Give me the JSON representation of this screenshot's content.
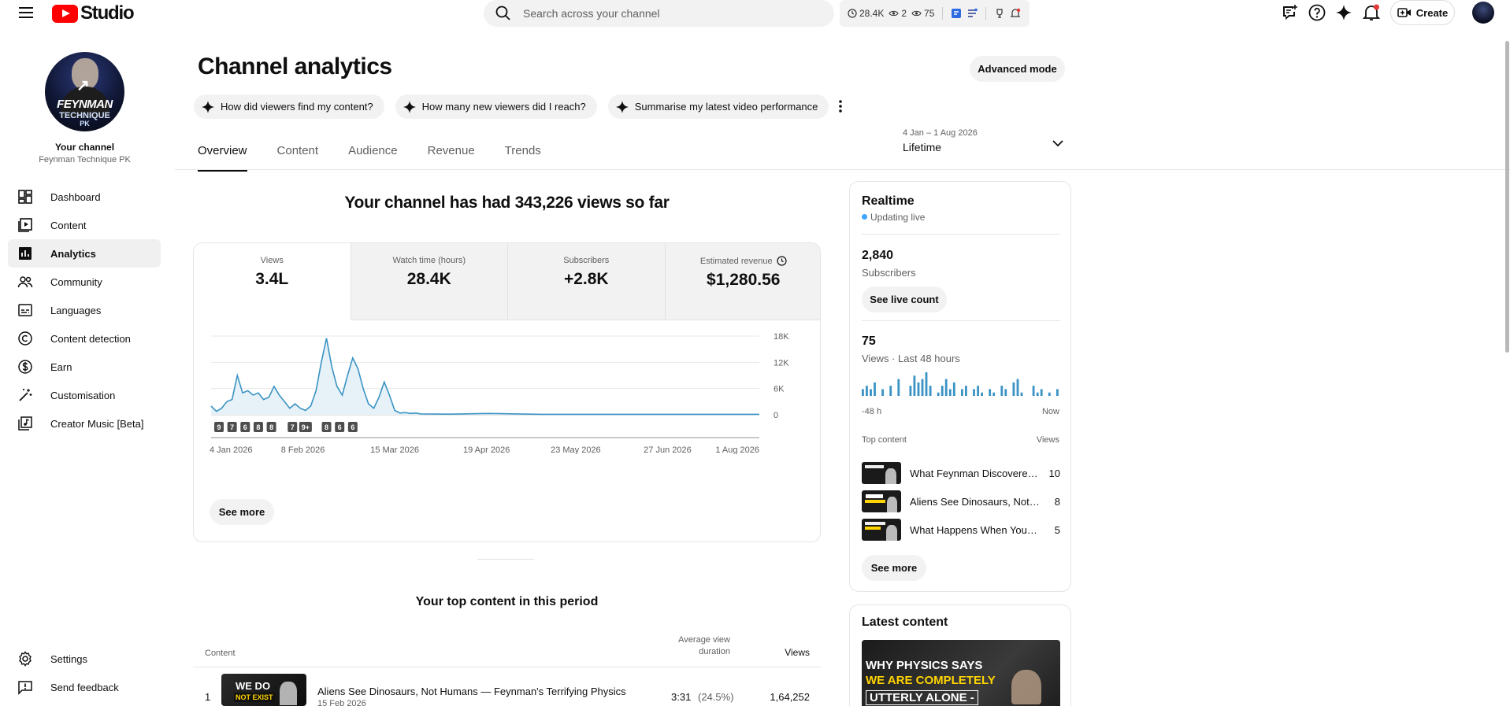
{
  "topbar": {
    "logo_text": "Studio",
    "search_placeholder": "Search across your channel",
    "ext_stats": {
      "watch": "28.4K",
      "live": "2",
      "views": "75"
    },
    "create_label": "Create"
  },
  "sidebar": {
    "your_channel": "Your channel",
    "channel_name": "Feynman Technique PK",
    "avatar_text": {
      "line1": "FEYNMAN",
      "line2": "TECHNIQUE",
      "line3": "PK"
    },
    "items": [
      {
        "label": "Dashboard",
        "icon": "dashboard-icon"
      },
      {
        "label": "Content",
        "icon": "content-icon"
      },
      {
        "label": "Analytics",
        "icon": "analytics-icon"
      },
      {
        "label": "Community",
        "icon": "community-icon"
      },
      {
        "label": "Languages",
        "icon": "languages-icon"
      },
      {
        "label": "Content detection",
        "icon": "copyright-icon"
      },
      {
        "label": "Earn",
        "icon": "earn-icon"
      },
      {
        "label": "Customisation",
        "icon": "customisation-icon"
      },
      {
        "label": "Creator Music [Beta]",
        "icon": "music-icon"
      }
    ],
    "bottom": [
      {
        "label": "Settings",
        "icon": "gear-icon"
      },
      {
        "label": "Send feedback",
        "icon": "feedback-icon"
      }
    ]
  },
  "header": {
    "title": "Channel analytics",
    "advanced_mode": "Advanced mode",
    "chips": [
      "How did viewers find my content?",
      "How many new viewers did I reach?",
      "Summarise my latest video performance"
    ],
    "tabs": [
      "Overview",
      "Content",
      "Audience",
      "Revenue",
      "Trends"
    ],
    "date_range": "4 Jan – 1 Aug 2026",
    "date_value": "Lifetime"
  },
  "overview": {
    "headline": "Your channel has had 343,226 views so far",
    "metrics": [
      {
        "label": "Views",
        "value": "3.4L"
      },
      {
        "label": "Watch time (hours)",
        "value": "28.4K"
      },
      {
        "label": "Subscribers",
        "value": "+2.8K"
      },
      {
        "label": "Estimated revenue",
        "value": "$1,280.56"
      }
    ],
    "see_more": "See more"
  },
  "chart_data": {
    "type": "area",
    "ylabel_ticks": [
      "0",
      "6K",
      "12K",
      "18K"
    ],
    "ylim": [
      0,
      18000
    ],
    "x_tick_labels": [
      "4 Jan 2026",
      "8 Feb 2026",
      "15 Mar 2026",
      "19 Apr 2026",
      "23 May 2026",
      "27 Jun 2026",
      "1 Aug 2026"
    ],
    "x_tick_dates": [
      "2026-01-04",
      "2026-02-08",
      "2026-03-15",
      "2026-04-19",
      "2026-05-23",
      "2026-06-27",
      "2026-08-01"
    ],
    "x": [
      "2026-01-04",
      "2026-01-06",
      "2026-01-08",
      "2026-01-10",
      "2026-01-12",
      "2026-01-14",
      "2026-01-16",
      "2026-01-18",
      "2026-01-20",
      "2026-01-22",
      "2026-01-24",
      "2026-01-26",
      "2026-01-28",
      "2026-01-30",
      "2026-02-01",
      "2026-02-03",
      "2026-02-05",
      "2026-02-07",
      "2026-02-09",
      "2026-02-11",
      "2026-02-13",
      "2026-02-15",
      "2026-02-17",
      "2026-02-19",
      "2026-02-21",
      "2026-02-23",
      "2026-02-25",
      "2026-02-27",
      "2026-03-01",
      "2026-03-03",
      "2026-03-05",
      "2026-03-07",
      "2026-03-09",
      "2026-03-11",
      "2026-03-13",
      "2026-03-15",
      "2026-03-17",
      "2026-03-19",
      "2026-03-21",
      "2026-03-23",
      "2026-03-25",
      "2026-04-05",
      "2026-04-20",
      "2026-05-10",
      "2026-06-01",
      "2026-06-20",
      "2026-07-10",
      "2026-08-01"
    ],
    "values": [
      2000,
      800,
      1500,
      3000,
      3500,
      9000,
      5000,
      5500,
      4500,
      5000,
      3500,
      4000,
      6500,
      4500,
      3000,
      1500,
      2500,
      1500,
      1000,
      2000,
      5500,
      12000,
      17500,
      11000,
      6500,
      4500,
      9000,
      13000,
      10500,
      6000,
      2500,
      1500,
      4000,
      7500,
      4500,
      1000,
      400,
      500,
      300,
      400,
      200,
      150,
      300,
      100,
      100,
      100,
      100,
      100
    ],
    "annotation_markers": [
      {
        "x": "2026-01-07",
        "label": "9"
      },
      {
        "x": "2026-01-12",
        "label": "7"
      },
      {
        "x": "2026-01-17",
        "label": "6"
      },
      {
        "x": "2026-01-22",
        "label": "8"
      },
      {
        "x": "2026-01-27",
        "label": "8"
      },
      {
        "x": "2026-02-04",
        "label": "7"
      },
      {
        "x": "2026-02-09",
        "label": "9+"
      },
      {
        "x": "2026-02-17",
        "label": "8"
      },
      {
        "x": "2026-02-22",
        "label": "6"
      },
      {
        "x": "2026-02-27",
        "label": "6"
      }
    ],
    "colors": {
      "line": "#3a93c4",
      "fill": "#e6f1f8"
    },
    "grid": true
  },
  "top_content": {
    "title": "Your top content in this period",
    "col_content": "Content",
    "col_avd": "Average view duration",
    "col_views": "Views",
    "rows": [
      {
        "rank": "1",
        "thumb_line1": "WE DO",
        "thumb_line2": "NOT EXIST",
        "title": "Aliens See Dinosaurs, Not Humans — Feynman's Terrifying Physics",
        "date": "15 Feb 2026",
        "avd": "3:31",
        "avd_pct": "(24.5%)",
        "views": "1,64,252"
      }
    ]
  },
  "realtime": {
    "title": "Realtime",
    "status": "Updating live",
    "subs_value": "2,840",
    "subs_label": "Subscribers",
    "live_count_btn": "See live count",
    "views_value": "75",
    "views_label": "Views · Last 48 hours",
    "range_start": "-48 h",
    "range_end": "Now",
    "hourly_views": [
      2,
      3,
      2,
      4,
      0,
      2,
      0,
      3,
      0,
      5,
      0,
      0,
      3,
      6,
      4,
      5,
      7,
      3,
      0,
      1,
      3,
      5,
      2,
      4,
      0,
      2,
      3,
      0,
      2,
      3,
      1,
      0,
      2,
      1,
      0,
      3,
      2,
      0,
      4,
      5,
      1,
      0,
      0,
      3,
      1,
      2,
      0,
      1,
      0,
      2
    ],
    "top_content_label": "Top content",
    "views_col_label": "Views",
    "items": [
      {
        "title": "What Feynman Discovered About Learning",
        "views": "10"
      },
      {
        "title": "Aliens See Dinosaurs, Not Humans",
        "views": "8"
      },
      {
        "title": "What Happens When You Die",
        "views": "5"
      }
    ],
    "see_more": "See more"
  },
  "latest": {
    "title": "Latest content",
    "thumb_lines": [
      "WHY PHYSICS SAYS",
      "WE ARE COMPLETELY",
      "UTTERLY ALONE -"
    ]
  }
}
